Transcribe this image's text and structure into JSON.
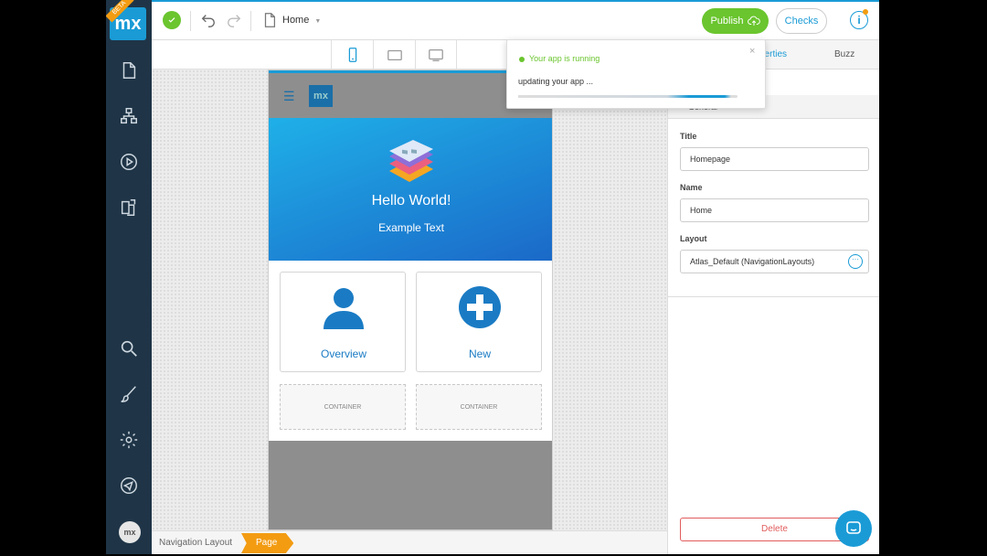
{
  "toolbar": {
    "page_name": "Home",
    "publish_label": "Publish",
    "checks_label": "Checks",
    "info_label": "i"
  },
  "nav": {
    "logo_text": "mx",
    "beta_label": "BETA",
    "avatar_text": "mx",
    "icons": [
      "page-icon",
      "domain-model-icon",
      "run-icon",
      "pages-icon",
      "search-icon",
      "brush-icon",
      "settings-icon",
      "feedback-icon"
    ]
  },
  "phone": {
    "logo_text": "mx",
    "hero_title": "Hello World!",
    "hero_text": "Example Text",
    "cards": [
      {
        "label": "Overview"
      },
      {
        "label": "New"
      }
    ],
    "containers": [
      "CONTAINER",
      "CONTAINER"
    ]
  },
  "panel": {
    "tabs": [
      "perties",
      "Buzz"
    ],
    "section": "General",
    "fields": [
      {
        "label": "Title",
        "value": "Homepage"
      },
      {
        "label": "Name",
        "value": "Home"
      },
      {
        "label": "Layout",
        "value": "Atlas_Default (NavigationLayouts)"
      }
    ],
    "more_label": "···",
    "delete_label": "Delete"
  },
  "toast": {
    "title": "Your app is running",
    "message": "updating your app ...",
    "progress": 0.97,
    "close": "×"
  },
  "breadcrumb": {
    "items": [
      "Navigation Layout",
      "Page"
    ]
  },
  "colors": {
    "brand_blue": "#1a9bd6",
    "green": "#6ac52e",
    "orange": "#f39c12",
    "nav_dark": "#1f3547",
    "danger": "#e25c5c"
  }
}
